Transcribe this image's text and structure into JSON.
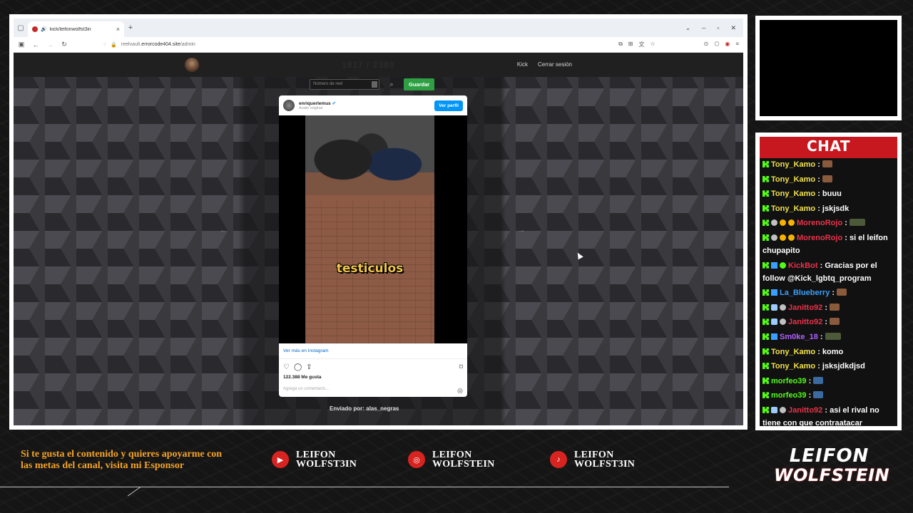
{
  "browser": {
    "tab_title": "kick/leifonwolfst3in",
    "tab_close": "×",
    "new_tab": "+",
    "url_prefix": "reelvault.",
    "url_domain": "errorcode404.site",
    "url_path": "/admin"
  },
  "site": {
    "faded_counter": "1817 / 2380",
    "nav": [
      "Kick",
      "Cerrar sesión"
    ],
    "reel_input_placeholder": "Número de reel",
    "save_label": "Guardar",
    "sent_by": "Enviado por: alas_negras",
    "arrow_left": "←",
    "arrow_right": "→"
  },
  "instagram": {
    "username": "enriquerlemus",
    "subtitle": "Audio original",
    "follow_label": "Ver perfil",
    "overlay_caption": "testiculos",
    "more_link": "Ver más en Instagram",
    "likes": "122.388 Me gusta",
    "comment_placeholder": "Agrega un comentario..."
  },
  "chat": {
    "title": "CHAT",
    "messages": [
      {
        "user": "Tony_Kamo",
        "text": "",
        "color": "#f2e24a",
        "badges": [
          "kick"
        ],
        "emote": "brown"
      },
      {
        "user": "Tony_Kamo",
        "text": "",
        "color": "#f2e24a",
        "badges": [
          "kick"
        ],
        "emote": "brown"
      },
      {
        "user": "Tony_Kamo",
        "text": "buuu",
        "color": "#f2e24a",
        "badges": [
          "kick"
        ]
      },
      {
        "user": "Tony_Kamo",
        "text": "jskjsdk",
        "color": "#f2e24a",
        "badges": [
          "kick"
        ]
      },
      {
        "user": "MorenoRojo",
        "text": "",
        "color": "#e8334a",
        "badges": [
          "kick",
          "mod",
          "sub",
          "sub"
        ],
        "emote": "tank"
      },
      {
        "user": "MorenoRojo",
        "text": "si el leifon chupapito",
        "color": "#e8334a",
        "badges": [
          "kick",
          "mod",
          "sub",
          "sub"
        ]
      },
      {
        "user": "KickBot",
        "text": "Gracias por el follow @Kick_lgbtq_program",
        "color": "#e8334a",
        "badges": [
          "kick",
          "gift",
          "ver"
        ]
      },
      {
        "user": "La_Blueberry",
        "text": "",
        "color": "#3aa0ff",
        "badges": [
          "kick",
          "gift"
        ],
        "emote": "brown"
      },
      {
        "user": "Janitto92",
        "text": "",
        "color": "#e8334a",
        "badges": [
          "kick",
          "gem",
          "mod"
        ],
        "emote": "brown"
      },
      {
        "user": "Janitto92",
        "text": "",
        "color": "#e8334a",
        "badges": [
          "kick",
          "gem",
          "mod"
        ],
        "emote": "brown"
      },
      {
        "user": "Sm0ke_18",
        "text": "",
        "color": "#b060ff",
        "badges": [
          "kick",
          "gift"
        ],
        "emote": "tank"
      },
      {
        "user": "Tony_Kamo",
        "text": "komo",
        "color": "#f2e24a",
        "badges": [
          "kick"
        ]
      },
      {
        "user": "Tony_Kamo",
        "text": "jsksjdkdjsd",
        "color": "#f2e24a",
        "badges": [
          "kick"
        ]
      },
      {
        "user": "morfeo39",
        "text": "",
        "color": "#53fc18",
        "badges": [
          "kick"
        ],
        "emote": "blue"
      },
      {
        "user": "morfeo39",
        "text": "",
        "color": "#53fc18",
        "badges": [
          "kick"
        ],
        "emote": "blue"
      },
      {
        "user": "Janitto92",
        "text": "asi el rival no tiene con que contraatacar",
        "color": "#e8334a",
        "badges": [
          "kick",
          "gem",
          "mod"
        ]
      }
    ]
  },
  "bottom": {
    "promo": "Si te gusta el contenido y quieres apoyarme con las metas del canal, visita mi Esponsor",
    "socials": [
      {
        "icon": "youtube-icon",
        "glyph": "▶",
        "line1": "LEIFON",
        "line2": "WOLFST3IN"
      },
      {
        "icon": "instagram-icon",
        "glyph": "◎",
        "line1": "LEIFON",
        "line2": "WOLFSTEIN"
      },
      {
        "icon": "tiktok-icon",
        "glyph": "♪",
        "line1": "LEIFON",
        "line2": "WOLFST3IN"
      }
    ],
    "brand_line1": "LEIFON",
    "brand_line2": "WOLFSTEIN"
  },
  "colors": {
    "accent_red": "#c8181f",
    "promo_orange": "#f4a325",
    "kick_green": "#53fc18",
    "save_green": "#2ea043"
  }
}
